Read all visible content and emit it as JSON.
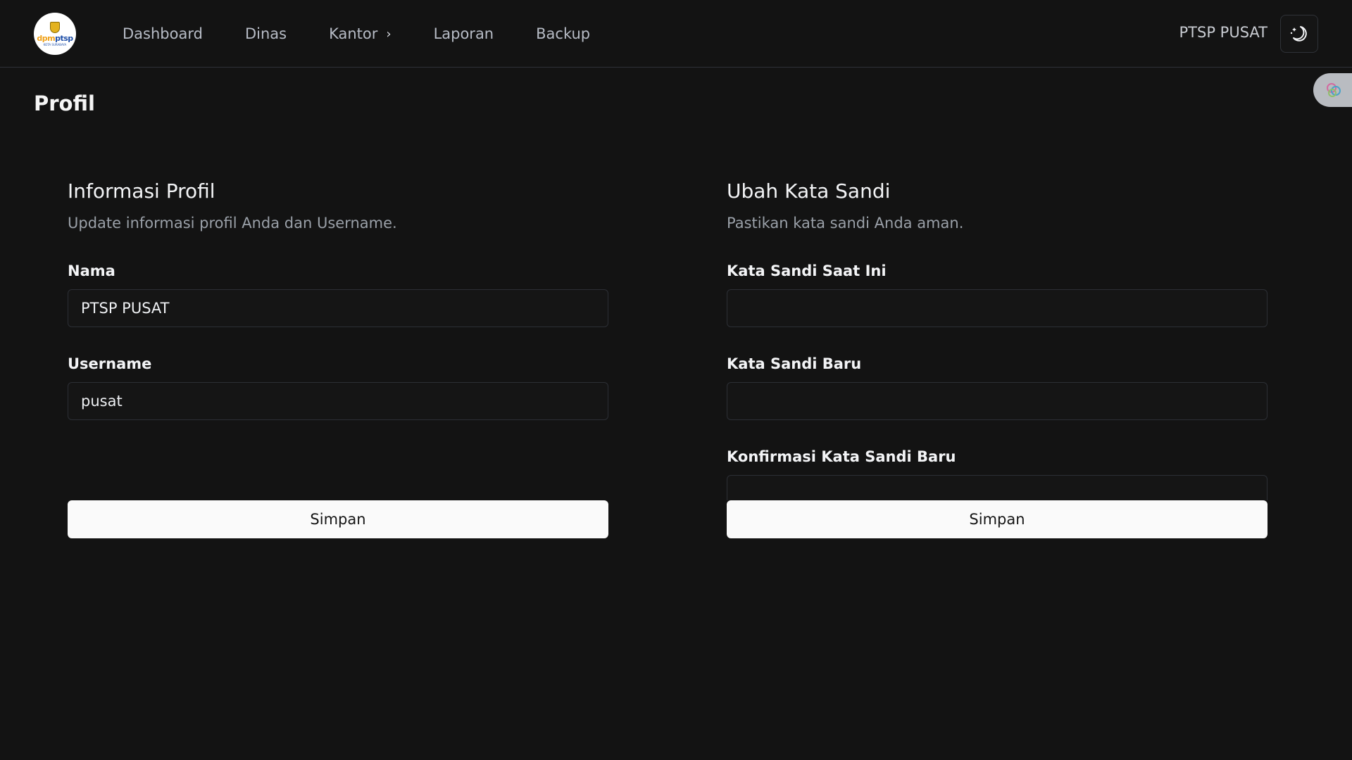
{
  "nav": {
    "logo": {
      "brand_left": "dpm",
      "brand_right": "ptsp",
      "city": "KOTA SURABAYA"
    },
    "items": [
      {
        "label": "Dashboard"
      },
      {
        "label": "Dinas"
      },
      {
        "label": "Kantor",
        "has_submenu": true,
        "chevron": "›"
      },
      {
        "label": "Laporan"
      },
      {
        "label": "Backup"
      }
    ],
    "user_name": "PTSP PUSAT",
    "theme_icon": "moon-stars-icon"
  },
  "page": {
    "title": "Profil"
  },
  "profile_card": {
    "title": "Informasi Profil",
    "description": "Update informasi profil Anda dan Username.",
    "fields": {
      "name_label": "Nama",
      "name_value": "PTSP PUSAT",
      "username_label": "Username",
      "username_value": "pusat"
    },
    "save_label": "Simpan"
  },
  "password_card": {
    "title": "Ubah Kata Sandi",
    "description": "Pastikan kata sandi Anda aman.",
    "fields": {
      "current_label": "Kata Sandi Saat Ini",
      "current_value": "",
      "new_label": "Kata Sandi Baru",
      "new_value": "",
      "confirm_label": "Konfirmasi Kata Sandi Baru",
      "confirm_value": ""
    },
    "save_label": "Simpan"
  },
  "colors": {
    "background": "#131313",
    "text": "#f3f4f6",
    "muted": "#9aa0a8",
    "button_bg": "#fafafa",
    "button_text": "#151515"
  }
}
